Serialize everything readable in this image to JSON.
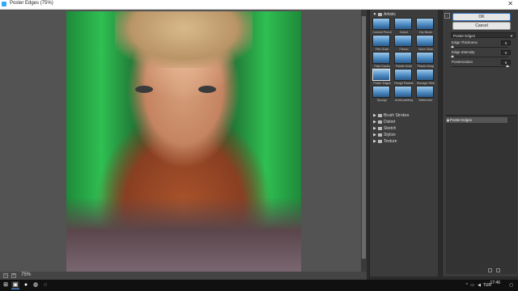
{
  "window": {
    "title": "Poster Edges (75%)"
  },
  "preview": {
    "zoom_label": "75%",
    "zoom_out": "−",
    "zoom_in": "+"
  },
  "gallery": {
    "open_category": "Artistic",
    "filters": [
      "Colored Pencil",
      "Cutout",
      "Dry Brush",
      "Film Grain",
      "Fresco",
      "Neon Glow",
      "Paint Daubs",
      "Palette Knife",
      "Plastic Wrap",
      "Poster Edges",
      "Rough Pastels",
      "Smudge Stick",
      "Sponge",
      "Underpainting",
      "Watercolor"
    ],
    "selected_filter": "Poster Edges",
    "categories": [
      "Brush Strokes",
      "Distort",
      "Sketch",
      "Stylize",
      "Texture"
    ]
  },
  "settings": {
    "ok": "OK",
    "cancel": "Cancel",
    "filter_select": "Poster Edges",
    "params": [
      {
        "label": "Edge Thickness",
        "value": "0",
        "fraction": 0.0
      },
      {
        "label": "Edge Intensity",
        "value": "0",
        "fraction": 0.0
      },
      {
        "label": "Posterization",
        "value": "6",
        "fraction": 1.0
      }
    ],
    "layer_name": "Poster Edges"
  },
  "taskbar": {
    "language": "TUR",
    "time": "17:46"
  }
}
